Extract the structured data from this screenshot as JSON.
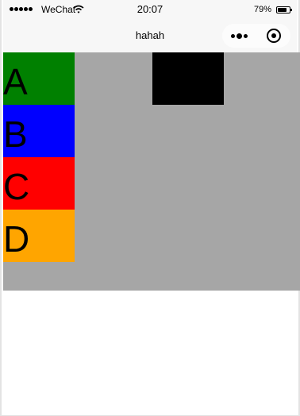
{
  "status_bar": {
    "carrier": "WeChat",
    "time": "20:07",
    "battery_percent": "79%",
    "battery_level": 0.79,
    "signal_bars": 5,
    "icons": [
      "signal-dots-icon",
      "wifi-icon",
      "battery-icon"
    ]
  },
  "nav_bar": {
    "title": "hahah",
    "icons": [
      "more-icon",
      "close-capsule-icon"
    ]
  },
  "content": {
    "background_color": "#a6a6a6",
    "blocks": [
      {
        "label": "A",
        "color": "#008000"
      },
      {
        "label": "B",
        "color": "#0000ff"
      },
      {
        "label": "C",
        "color": "#ff0000"
      },
      {
        "label": "D",
        "color": "#ffa500"
      }
    ],
    "black_box_color": "#000000"
  }
}
